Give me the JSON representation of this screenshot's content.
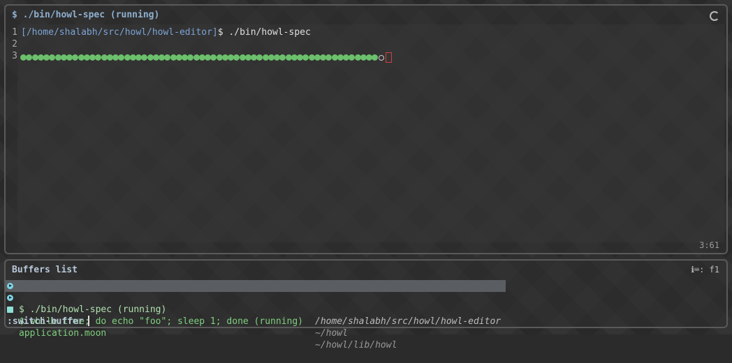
{
  "editor": {
    "title": "$ ./bin/howl-spec (running)",
    "line_numbers": [
      "1",
      "2",
      "3"
    ],
    "line1_path": "[/home/shalabh/src/howl/howl-editor]",
    "line1_cmd": "$ ./bin/howl-spec",
    "progress_dots_count": 62,
    "status": "3:61",
    "spinner_icon": "spinner-icon"
  },
  "buffers": {
    "title": "Buffers list",
    "help": "ℹ⌨: f1",
    "items": [
      {
        "name": "$ ./bin/howl-spec (running)",
        "dir": "/home/shalabh/src/howl/howl-editor",
        "icon": "process-icon",
        "selected": true
      },
      {
        "name": "$ while true; do echo \"foo\"; sleep 1; done (running)",
        "dir": "~/howl",
        "icon": "process-icon",
        "selected": false
      },
      {
        "name": "application.moon",
        "dir": "~/howl/lib/howl",
        "icon": "file-icon",
        "selected": false
      }
    ],
    "prompt": ":switch-buffer"
  },
  "colors": {
    "accent": "#8fb0d0",
    "progress": "#6cc06c",
    "selected_row": "#5a5e62"
  }
}
